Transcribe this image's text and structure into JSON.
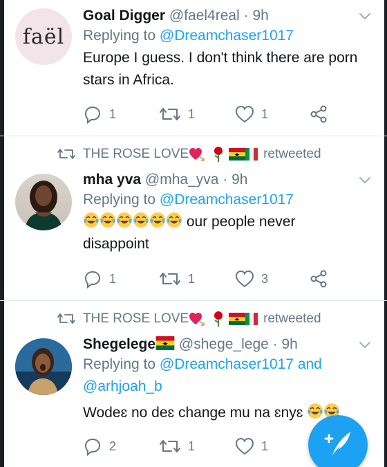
{
  "tweets": [
    {
      "name": "Goal Digger",
      "handle": "@fael4real",
      "separator": "·",
      "time": "9h",
      "replying_prefix": "Replying to ",
      "replying_mention": "@Dreamchaser1017",
      "text": "Europe I guess. I don't think there are porn stars in Africa.",
      "avatar_text": "faël",
      "reply_count": "1",
      "retweet_count": "1",
      "like_count": "1"
    },
    {
      "retweeted_by": "THE ROSE LOVE",
      "retweeted_suffix": "retweeted",
      "name": "mha yva",
      "handle": "@mha_yva",
      "separator": "·",
      "time": "9h",
      "replying_prefix": "Replying to ",
      "replying_mention": "@Dreamchaser1017",
      "text_after_emoji": "our people never disappoint",
      "reply_count": "1",
      "retweet_count": "1",
      "like_count": "3"
    },
    {
      "retweeted_by": "THE ROSE LOVE",
      "retweeted_suffix": "retweeted",
      "name": "Shegelege",
      "handle": "@shege_lege",
      "separator": "·",
      "time": "9h",
      "replying_prefix": "Replying to ",
      "replying_mention": "@Dreamchaser1017",
      "replying_and": " and",
      "replying_mention_2": "@arhjoah_b",
      "text": "Wodeɛ no deɛ change mu na ɛnyɛ",
      "reply_count": "2",
      "retweet_count": "1",
      "like_count": "1"
    }
  ],
  "colors": {
    "accent": "#1da1f2",
    "secondary_text": "#657786",
    "primary_text": "#14171a",
    "divider": "#e1e8ed"
  },
  "icons": [
    "chevron-down-icon",
    "reply-icon",
    "retweet-icon",
    "like-icon",
    "share-icon",
    "compose-tweet-icon",
    "laughing-emoji-icon",
    "heart-emoji-icon",
    "rose-emoji-icon",
    "ghana-flag-icon",
    "italy-flag-icon"
  ]
}
